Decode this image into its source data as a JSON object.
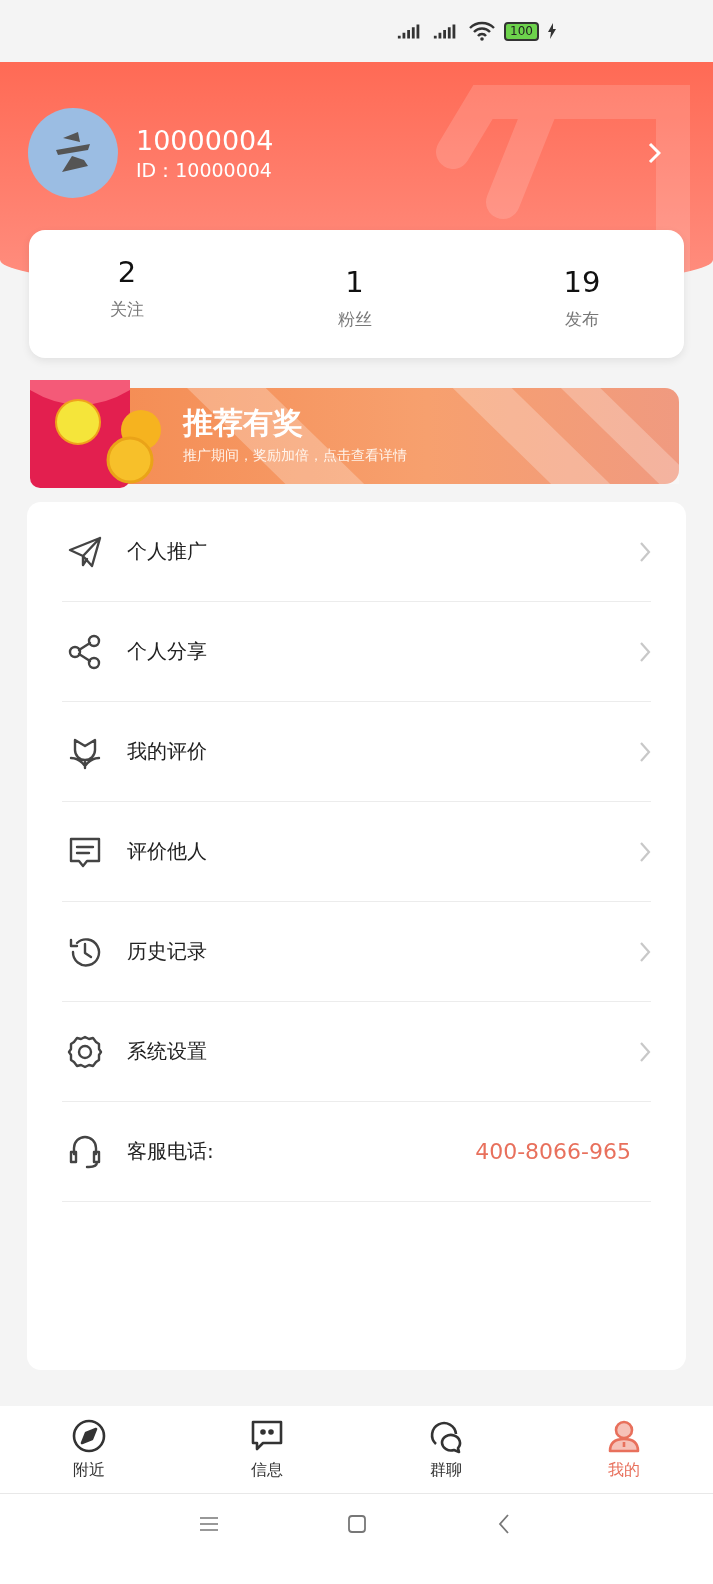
{
  "status_bar": {
    "battery": "100"
  },
  "profile": {
    "name": "10000004",
    "id_label": "ID：10000004"
  },
  "stats": [
    {
      "value": "2",
      "label": "关注"
    },
    {
      "value": "1",
      "label": "粉丝"
    },
    {
      "value": "19",
      "label": "发布"
    }
  ],
  "banner": {
    "title": "推荐有奖",
    "subtitle": "推广期间，奖励加倍，点击查看详情"
  },
  "menu": [
    {
      "kind": "link",
      "label": "个人推广"
    },
    {
      "kind": "link",
      "label": "个人分享"
    },
    {
      "kind": "link",
      "label": "我的评价"
    },
    {
      "kind": "link",
      "label": "评价他人"
    },
    {
      "kind": "link",
      "label": "历史记录"
    },
    {
      "kind": "link",
      "label": "系统设置"
    },
    {
      "kind": "phone",
      "label": "客服电话:",
      "value": "400-8066-965"
    }
  ],
  "tabs": [
    {
      "label": "附近",
      "selected": false
    },
    {
      "label": "信息",
      "selected": false
    },
    {
      "label": "群聊",
      "selected": false
    },
    {
      "label": "我的",
      "selected": true
    }
  ]
}
